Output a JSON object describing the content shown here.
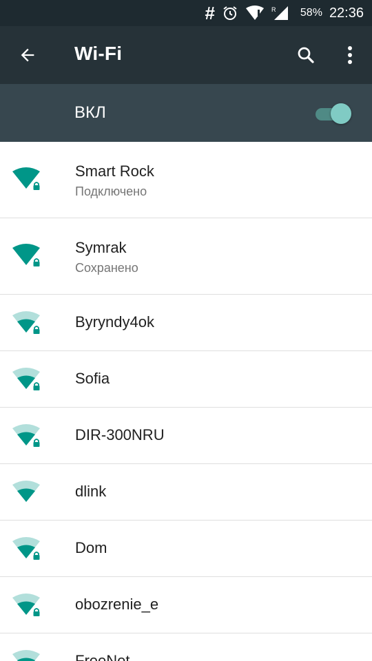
{
  "status_bar": {
    "hash": "#",
    "battery": "58%",
    "time": "22:36",
    "icons": [
      "hash-icon",
      "alarm-icon",
      "wifi-signal-icon",
      "cell-signal-icon",
      "battery-icon"
    ]
  },
  "appbar": {
    "title": "Wi-Fi",
    "back_icon": "arrow-back-icon",
    "search_icon": "search-icon",
    "more_icon": "more-vert-icon"
  },
  "switch": {
    "label": "ВКЛ",
    "on": true
  },
  "colors": {
    "statusbar": "#1e2a30",
    "appbar": "#263238",
    "switchbar": "#37474f",
    "accent": "#009688",
    "accent_light": "#b2dfdb"
  },
  "networks": [
    {
      "name": "Smart Rock",
      "status": "Подключено",
      "secured": true,
      "strength": 4
    },
    {
      "name": "Symrak",
      "status": "Сохранено",
      "secured": true,
      "strength": 4
    },
    {
      "name": "Byryndy4ok",
      "status": "",
      "secured": true,
      "strength": 2
    },
    {
      "name": "Sofia",
      "status": "",
      "secured": true,
      "strength": 2
    },
    {
      "name": "DIR-300NRU",
      "status": "",
      "secured": true,
      "strength": 2
    },
    {
      "name": "dlink",
      "status": "",
      "secured": false,
      "strength": 2
    },
    {
      "name": "Dom",
      "status": "",
      "secured": true,
      "strength": 2
    },
    {
      "name": "obozrenie_e",
      "status": "",
      "secured": true,
      "strength": 2
    },
    {
      "name": "FreeNet",
      "status": "",
      "secured": false,
      "strength": 2
    }
  ]
}
